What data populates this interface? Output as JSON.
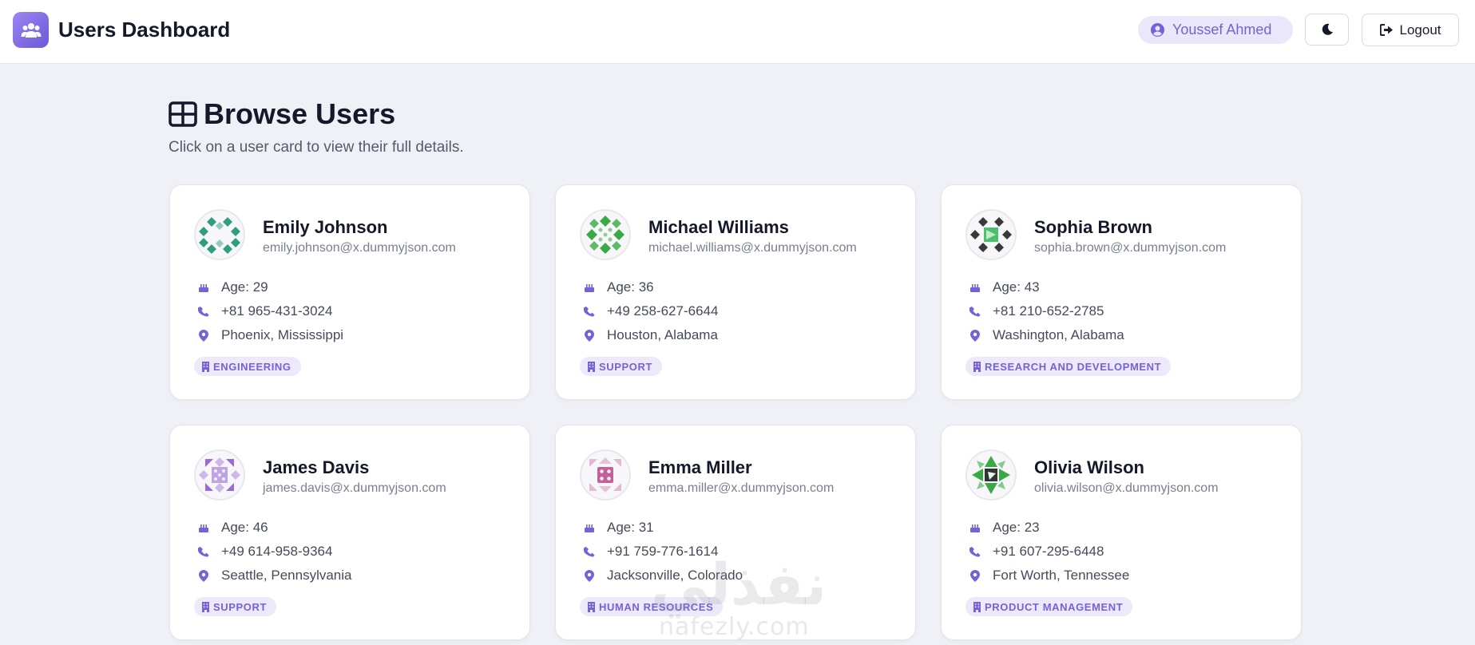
{
  "header": {
    "title": "Users Dashboard",
    "user_name": "Youssef Ahmed",
    "logout_label": "Logout",
    "icons": {
      "logo": "users-icon",
      "user": "user-circle-icon",
      "theme": "moon-icon",
      "logout": "sign-out-icon"
    }
  },
  "page": {
    "title": "Browse Users",
    "subtitle": "Click on a user card to view their full details."
  },
  "colors": {
    "accent": "#7562d6",
    "accent_light": "#ede9fb",
    "background": "#eff1f6"
  },
  "users": [
    {
      "name": "Emily Johnson",
      "email": "emily.johnson@x.dummyjson.com",
      "age": "Age: 29",
      "phone": "+81 965-431-3024",
      "location": "Phoenix, Mississippi",
      "department": "ENGINEERING",
      "avatar_color": "#2f9e7e"
    },
    {
      "name": "Michael Williams",
      "email": "michael.williams@x.dummyjson.com",
      "age": "Age: 36",
      "phone": "+49 258-627-6644",
      "location": "Houston, Alabama",
      "department": "SUPPORT",
      "avatar_color": "#3aa845"
    },
    {
      "name": "Sophia Brown",
      "email": "sophia.brown@x.dummyjson.com",
      "age": "Age: 43",
      "phone": "+81 210-652-2785",
      "location": "Washington, Alabama",
      "department": "RESEARCH AND DEVELOPMENT",
      "avatar_color": "#4cbf6a"
    },
    {
      "name": "James Davis",
      "email": "james.davis@x.dummyjson.com",
      "age": "Age: 46",
      "phone": "+49 614-958-9364",
      "location": "Seattle, Pennsylvania",
      "department": "SUPPORT",
      "avatar_color": "#9b6ad6"
    },
    {
      "name": "Emma Miller",
      "email": "emma.miller@x.dummyjson.com",
      "age": "Age: 31",
      "phone": "+91 759-776-1614",
      "location": "Jacksonville, Colorado",
      "department": "HUMAN RESOURCES",
      "avatar_color": "#c0619c"
    },
    {
      "name": "Olivia Wilson",
      "email": "olivia.wilson@x.dummyjson.com",
      "age": "Age: 23",
      "phone": "+91 607-295-6448",
      "location": "Fort Worth, Tennessee",
      "department": "PRODUCT MANAGEMENT",
      "avatar_color": "#3aa845"
    }
  ],
  "watermark": {
    "arabic": "نفذلي",
    "latin": "nafezly.com"
  }
}
